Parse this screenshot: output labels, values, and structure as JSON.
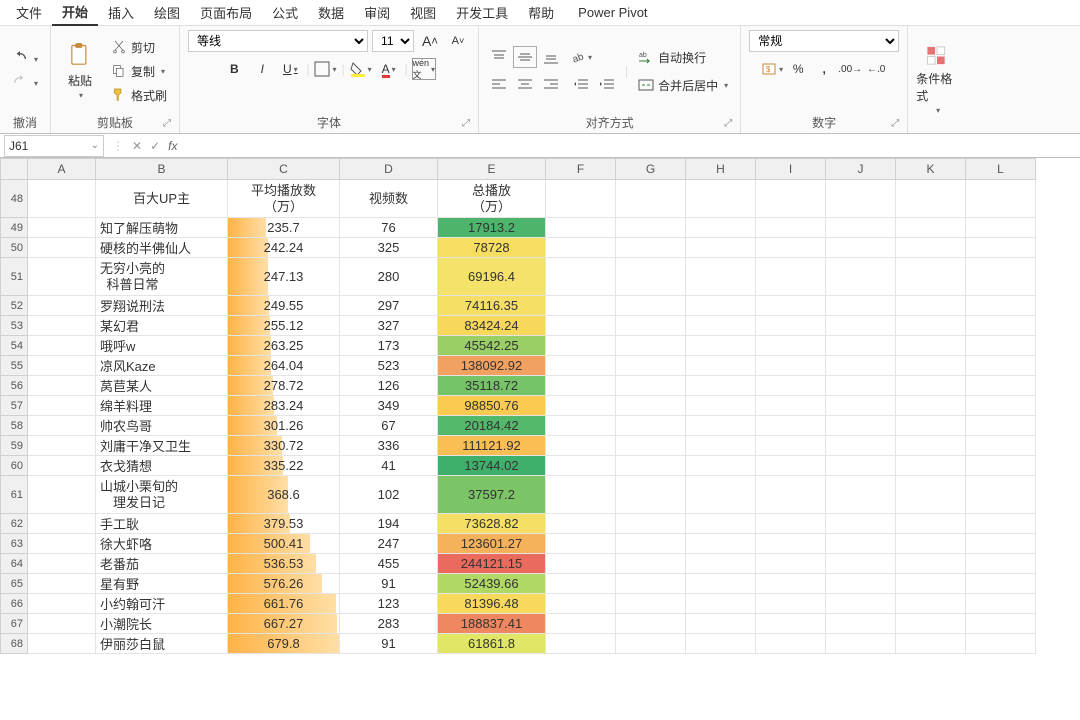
{
  "menu": [
    "文件",
    "开始",
    "插入",
    "绘图",
    "页面布局",
    "公式",
    "数据",
    "审阅",
    "视图",
    "开发工具",
    "帮助",
    "Power Pivot"
  ],
  "activeMenu": "开始",
  "ribbon": {
    "undoGroup": "撤消",
    "clipboardGroup": "剪贴板",
    "paste": "粘贴",
    "cut": "剪切",
    "copy": "复制",
    "formatPainter": "格式刷",
    "fontGroup": "字体",
    "fontName": "等线",
    "fontSize": "11",
    "alignGroup": "对齐方式",
    "wrap": "自动换行",
    "merge": "合并后居中",
    "numberGroup": "数字",
    "numberFormat": "常规",
    "condFmt": "条件格式"
  },
  "nameBox": "J61",
  "formula": "",
  "columns": [
    "A",
    "B",
    "C",
    "D",
    "E",
    "F",
    "G",
    "H",
    "I",
    "J",
    "K",
    "L"
  ],
  "headerRow": 48,
  "headers": {
    "B": "百大UP主",
    "C": "平均播放数\n（万）",
    "D": "视频数",
    "E": "总播放\n（万）"
  },
  "rows": [
    {
      "r": 49,
      "B": "知了解压萌物",
      "C": 235.7,
      "D": 76,
      "E": 17913.2,
      "ec": "#4cb56b"
    },
    {
      "r": 50,
      "B": "硬核的半佛仙人",
      "C": 242.24,
      "D": 325,
      "E": 78728,
      "ec": "#f7dd62"
    },
    {
      "r": 51,
      "B": "无穷小亮的\n科普日常",
      "C": 247.13,
      "D": 280,
      "E": 69196.4,
      "ec": "#f4e26a",
      "tall": true
    },
    {
      "r": 52,
      "B": "罗翔说刑法",
      "C": 249.55,
      "D": 297,
      "E": 74116.35,
      "ec": "#f6df66"
    },
    {
      "r": 53,
      "B": "某幻君",
      "C": 255.12,
      "D": 327,
      "E": 83424.24,
      "ec": "#f8d85b"
    },
    {
      "r": 54,
      "B": "哦呼w",
      "C": 263.25,
      "D": 173,
      "E": 45542.25,
      "ec": "#9acf65"
    },
    {
      "r": 55,
      "B": "凉风Kaze",
      "C": 264.04,
      "D": 523,
      "E": 138092.92,
      "ec": "#f3a161"
    },
    {
      "r": 56,
      "B": "莴苣某人",
      "C": 278.72,
      "D": 126,
      "E": 35118.72,
      "ec": "#77c368"
    },
    {
      "r": 57,
      "B": "绵羊料理",
      "C": 283.24,
      "D": 349,
      "E": 98850.76,
      "ec": "#fbca51"
    },
    {
      "r": 58,
      "B": "帅农鸟哥",
      "C": 301.26,
      "D": 67,
      "E": 20184.42,
      "ec": "#53b86a"
    },
    {
      "r": 59,
      "B": "刘庸干净又卫生",
      "C": 330.72,
      "D": 336,
      "E": 111121.92,
      "ec": "#f9bf55"
    },
    {
      "r": 60,
      "B": "衣戈猜想",
      "C": 335.22,
      "D": 41,
      "E": 13744.02,
      "ec": "#3fb06b"
    },
    {
      "r": 61,
      "B": "山城小栗旬的\n理发日记",
      "C": 368.6,
      "D": 102,
      "E": 37597.2,
      "ec": "#7cc567",
      "tall": true
    },
    {
      "r": 62,
      "B": "手工耿",
      "C": 379.53,
      "D": 194,
      "E": 73628.82,
      "ec": "#f6df66"
    },
    {
      "r": 63,
      "B": "徐大虾咯",
      "C": 500.41,
      "D": 247,
      "E": 123601.27,
      "ec": "#f6b25a"
    },
    {
      "r": 64,
      "B": "老番茄",
      "C": 536.53,
      "D": 455,
      "E": 244121.15,
      "ec": "#ea6b5e"
    },
    {
      "r": 65,
      "B": "星有野",
      "C": 576.26,
      "D": 91,
      "E": 52439.66,
      "ec": "#b0d864"
    },
    {
      "r": 66,
      "B": "小约翰可汗",
      "C": 661.76,
      "D": 123,
      "E": 81396.48,
      "ec": "#f8d95c"
    },
    {
      "r": 67,
      "B": "小潮院长",
      "C": 667.27,
      "D": 283,
      "E": 188837.41,
      "ec": "#ef8860"
    },
    {
      "r": 68,
      "B": "伊丽莎白鼠",
      "C": 679.8,
      "D": 91,
      "E": 61861.8,
      "ec": "#e1e667"
    }
  ],
  "cMax": 680,
  "chart_data": {
    "type": "table",
    "title": "百大UP主 播放数据",
    "columns": [
      "百大UP主",
      "平均播放数（万）",
      "视频数",
      "总播放（万）"
    ],
    "rows": [
      [
        "知了解压萌物",
        235.7,
        76,
        17913.2
      ],
      [
        "硬核的半佛仙人",
        242.24,
        325,
        78728
      ],
      [
        "无穷小亮的科普日常",
        247.13,
        280,
        69196.4
      ],
      [
        "罗翔说刑法",
        249.55,
        297,
        74116.35
      ],
      [
        "某幻君",
        255.12,
        327,
        83424.24
      ],
      [
        "哦呼w",
        263.25,
        173,
        45542.25
      ],
      [
        "凉风Kaze",
        264.04,
        523,
        138092.92
      ],
      [
        "莴苣某人",
        278.72,
        126,
        35118.72
      ],
      [
        "绵羊料理",
        283.24,
        349,
        98850.76
      ],
      [
        "帅农鸟哥",
        301.26,
        67,
        20184.42
      ],
      [
        "刘庸干净又卫生",
        330.72,
        336,
        111121.92
      ],
      [
        "衣戈猜想",
        335.22,
        41,
        13744.02
      ],
      [
        "山城小栗旬的理发日记",
        368.6,
        102,
        37597.2
      ],
      [
        "手工耿",
        379.53,
        194,
        73628.82
      ],
      [
        "徐大虾咯",
        500.41,
        247,
        123601.27
      ],
      [
        "老番茄",
        536.53,
        455,
        244121.15
      ],
      [
        "星有野",
        576.26,
        91,
        52439.66
      ],
      [
        "小约翰可汗",
        661.76,
        123,
        81396.48
      ],
      [
        "小潮院长",
        667.27,
        283,
        188837.41
      ],
      [
        "伊丽莎白鼠",
        679.8,
        91,
        61861.8
      ]
    ]
  }
}
